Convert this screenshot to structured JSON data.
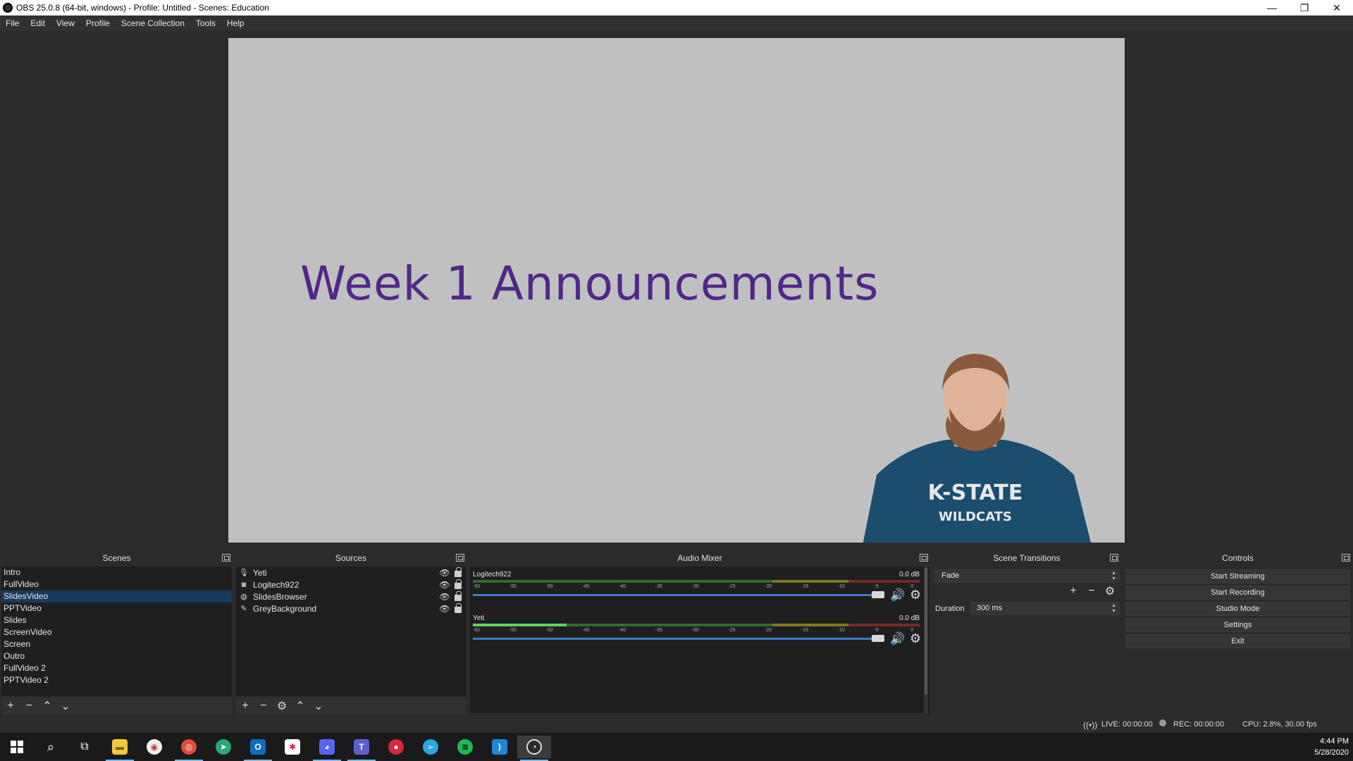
{
  "window": {
    "title": "OBS 25.0.8 (64-bit, windows) - Profile: Untitled - Scenes: Education",
    "minimize": "—",
    "restore": "❐",
    "close": "✕"
  },
  "menu": [
    "File",
    "Edit",
    "View",
    "Profile",
    "Scene Collection",
    "Tools",
    "Help"
  ],
  "preview": {
    "slide_title": "Week 1 Announcements",
    "shirt_text": "K-STATE",
    "shirt_sub": "WILDCATS"
  },
  "scenes": {
    "title": "Scenes",
    "items": [
      "Intro",
      "FullVideo",
      "SlidesVideo",
      "PPTVideo",
      "Slides",
      "ScreenVideo",
      "Screen",
      "Outro",
      "FullVideo 2",
      "PPTVideo 2"
    ],
    "selected": "SlidesVideo"
  },
  "sources": {
    "title": "Sources",
    "items": [
      {
        "name": "Yeti",
        "icon": "microphone-icon",
        "glyph": "🎙"
      },
      {
        "name": "Logitech922",
        "icon": "camera-icon",
        "glyph": "◙"
      },
      {
        "name": "SlidesBrowser",
        "icon": "globe-icon",
        "glyph": "◍"
      },
      {
        "name": "GreyBackground",
        "icon": "brush-icon",
        "glyph": "✎"
      }
    ]
  },
  "mixer": {
    "title": "Audio Mixer",
    "ticks": [
      "-60",
      "-55",
      "-50",
      "-45",
      "-40",
      "-35",
      "-30",
      "-25",
      "-20",
      "-15",
      "-10",
      "-5",
      "0"
    ],
    "channels": [
      {
        "name": "Logitech922",
        "db": "0.0 dB",
        "level": 0.0
      },
      {
        "name": "Yeti",
        "db": "0.0 dB",
        "level": 0.21
      }
    ]
  },
  "transitions": {
    "title": "Scene Transitions",
    "selected": "Fade",
    "duration_label": "Duration",
    "duration_value": "300 ms"
  },
  "controls": {
    "title": "Controls",
    "buttons": [
      "Start Streaming",
      "Start Recording",
      "Studio Mode",
      "Settings",
      "Exit"
    ]
  },
  "status": {
    "live": "LIVE: 00:00:00",
    "rec": "REC: 00:00:00",
    "cpu": "CPU: 2.8%, 30.00 fps"
  },
  "taskbar": {
    "time": "4:44 PM",
    "date": "5/28/2020",
    "apps": [
      {
        "name": "file-explorer",
        "color": "#f2c744",
        "glyph": "▬"
      },
      {
        "name": "app-red",
        "color": "#e8e8e8",
        "glyph": "◉"
      },
      {
        "name": "chrome",
        "color": "#dd4b39",
        "glyph": "◎"
      },
      {
        "name": "app-green-arrow",
        "color": "#2aa876",
        "glyph": "➤"
      },
      {
        "name": "outlook",
        "color": "#0f6cbd",
        "glyph": "O"
      },
      {
        "name": "slack",
        "color": "#ffffff",
        "glyph": "✱"
      },
      {
        "name": "discord",
        "color": "#5865f2",
        "glyph": "◕"
      },
      {
        "name": "teams",
        "color": "#5b5fc7",
        "glyph": "T"
      },
      {
        "name": "chat",
        "color": "#d7263d",
        "glyph": "●"
      },
      {
        "name": "telegram",
        "color": "#2ca5e0",
        "glyph": "➢"
      },
      {
        "name": "spotify",
        "color": "#1db954",
        "glyph": "≋"
      },
      {
        "name": "vscode",
        "color": "#1f86d6",
        "glyph": "⟩"
      },
      {
        "name": "obs",
        "color": "#2b2b2b",
        "glyph": "◔"
      }
    ]
  }
}
